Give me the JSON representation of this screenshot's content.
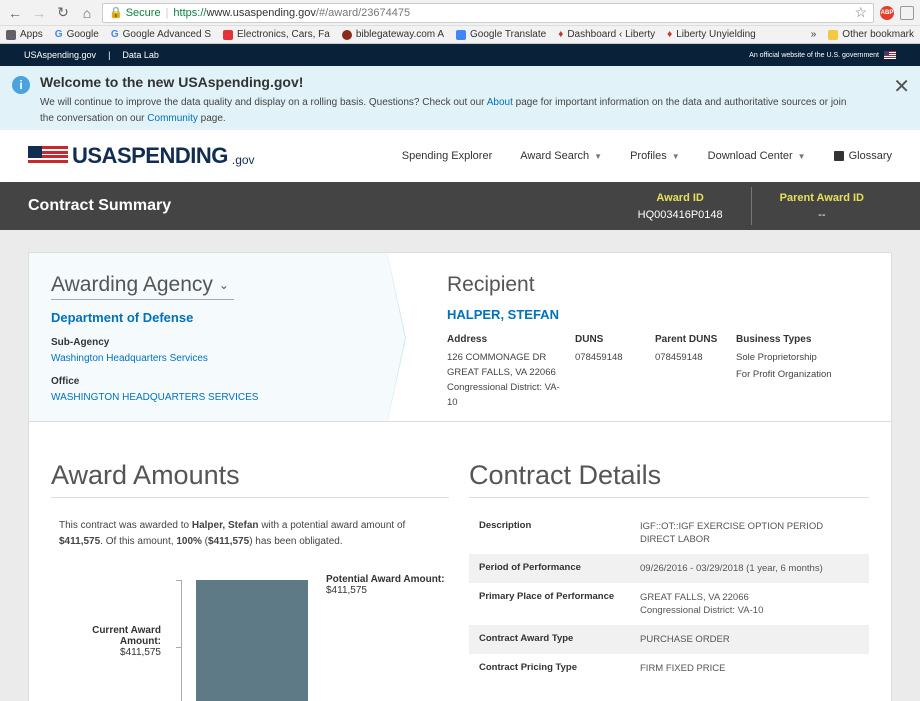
{
  "browser": {
    "secure_label": "Secure",
    "url_proto": "https://",
    "url_host": "www.usaspending.gov",
    "url_path": "/#/award/23674475"
  },
  "bookmarks": [
    "Apps",
    "Google",
    "Google Advanced S",
    "Electronics, Cars, Fa",
    "biblegateway.com A",
    "Google Translate",
    "Dashboard ‹ Liberty",
    "Liberty Unyielding",
    "Other bookmark"
  ],
  "gov_bar": {
    "site": "USAspending.gov",
    "datalab": "Data Lab",
    "official": "An official website of the U.S. government"
  },
  "banner": {
    "title": "Welcome to the new USAspending.gov!",
    "text_1": "We will continue to improve the data quality and display on a rolling basis. Questions? Check out our ",
    "about": "About",
    "text_2": " page for important information on the data and authoritative sources or join the conversation on our ",
    "community": "Community",
    "text_3": " page."
  },
  "header": {
    "logo_main": "USASPENDING",
    "logo_suffix": ".gov",
    "nav": [
      "Spending Explorer",
      "Award Search",
      "Profiles",
      "Download Center",
      "Glossary"
    ]
  },
  "summary": {
    "title": "Contract Summary",
    "award_id_label": "Award ID",
    "award_id": "HQ003416P0148",
    "parent_label": "Parent Award ID",
    "parent_id": "--"
  },
  "agency": {
    "heading": "Awarding Agency",
    "department": "Department of Defense",
    "sub_label": "Sub-Agency",
    "sub_value": "Washington Headquarters Services",
    "office_label": "Office",
    "office_value": "WASHINGTON HEADQUARTERS SERVICES"
  },
  "recipient": {
    "heading": "Recipient",
    "name": "HALPER, STEFAN",
    "address_label": "Address",
    "address": [
      "126 COMMONAGE DR",
      "GREAT FALLS, VA 22066",
      "Congressional District: VA-",
      "10"
    ],
    "duns_label": "DUNS",
    "duns": "078459148",
    "parent_duns_label": "Parent DUNS",
    "parent_duns": "078459148",
    "types_label": "Business Types",
    "types": [
      "Sole Proprietorship",
      "For Profit Organization"
    ]
  },
  "amounts": {
    "heading": "Award Amounts",
    "text_1": "This contract was awarded to ",
    "recipient": "Halper, Stefan",
    "text_2": " with a potential award amount of ",
    "potential": "$411,575",
    "text_3": ". Of this amount, ",
    "percent": "100%",
    "text_4": " (",
    "obligated": "$411,575",
    "text_5": ") has been obligated.",
    "potential_label": "Potential Award Amount:",
    "potential_value": "$411,575",
    "current_label": "Current Award Amount:",
    "current_value": "$411,575",
    "obligated_fraction": 1.0
  },
  "details": {
    "heading": "Contract Details",
    "rows": [
      {
        "k": "Description",
        "v": "IGF::OT::IGF EXERCISE OPTION PERIOD DIRECT LABOR"
      },
      {
        "k": "Period of Performance",
        "v": "09/26/2016 - 03/29/2018 (1 year, 6 months)"
      },
      {
        "k": "Primary Place of Performance",
        "v": "GREAT FALLS, VA 22066\nCongressional District: VA-10"
      },
      {
        "k": "Contract Award Type",
        "v": "PURCHASE ORDER"
      },
      {
        "k": "Contract Pricing Type",
        "v": "FIRM FIXED PRICE"
      }
    ]
  }
}
